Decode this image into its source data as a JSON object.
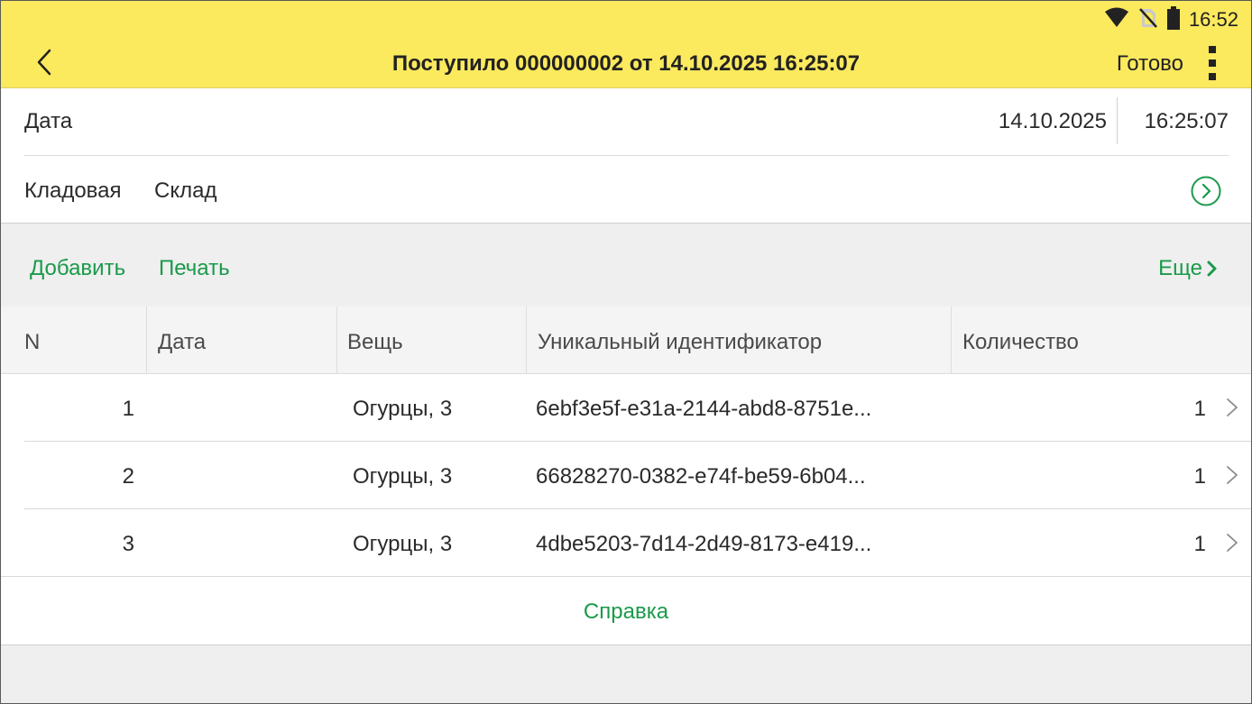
{
  "status": {
    "time": "16:52",
    "icons": [
      "wifi-icon",
      "no-sim-icon",
      "battery-icon"
    ]
  },
  "header": {
    "title": "Поступило 000000002 от 14.10.2025 16:25:07",
    "done_label": "Готово",
    "back_icon": "chevron-left-icon",
    "menu_icon": "more-vert-icon"
  },
  "form": {
    "date_label": "Дата",
    "date_value": "14.10.2025",
    "time_value": "16:25:07",
    "store_label": "Кладовая",
    "store_value": "Склад",
    "store_open_icon": "circle-chevron-right-icon"
  },
  "toolbar": {
    "add_label": "Добавить",
    "print_label": "Печать",
    "more_label": "Еще"
  },
  "table": {
    "columns": [
      "N",
      "Дата",
      "Вещь",
      "Уникальный идентификатор",
      "Количество"
    ],
    "rows": [
      {
        "n": "1",
        "date": "",
        "item": "Огурцы,  3",
        "uid": "6ebf3e5f-e31a-2144-abd8-8751e...",
        "qty": "1"
      },
      {
        "n": "2",
        "date": "",
        "item": "Огурцы,  3",
        "uid": "66828270-0382-e74f-be59-6b04...",
        "qty": "1"
      },
      {
        "n": "3",
        "date": "",
        "item": "Огурцы,  3",
        "uid": "4dbe5203-7d14-2d49-8173-e419...",
        "qty": "1"
      }
    ]
  },
  "footer": {
    "help_label": "Справка"
  },
  "colors": {
    "header_bg": "#fbe95e",
    "accent_green": "#1a9a4a",
    "toolbar_bg": "#efefef"
  }
}
